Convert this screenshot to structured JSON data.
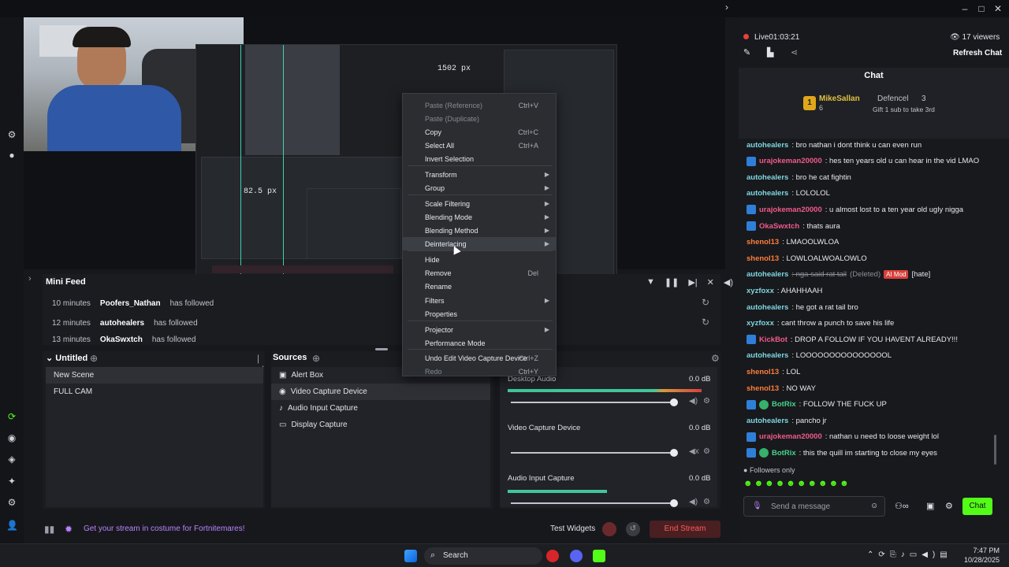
{
  "live": {
    "status_label": "Live",
    "timer": "01:03:21",
    "viewers": "17 viewers",
    "refresh_label": "Refresh Chat"
  },
  "chat": {
    "title": "Chat",
    "leader": {
      "rank": "1",
      "name": "MikeSallan",
      "count": "6",
      "runner_up": "Defencel",
      "runner_count": "3",
      "gift_text": "Gift 1 sub to take 3rd"
    },
    "lines": [
      {
        "user": "autohealers",
        "text": ": bro nathan i dont think u can even run",
        "style": "user"
      },
      {
        "user": "urajokeman20000",
        "text": ": hes ten years old u can hear in the vid LMAO",
        "style": "user-r"
      },
      {
        "user": "autohealers",
        "text": ": bro he cat fightin",
        "style": "user"
      },
      {
        "user": "autohealers",
        "text": ": LOLOLOL",
        "style": "user"
      },
      {
        "user": "urajokeman20000",
        "text": ": u almost lost to a ten year old ugly nigga",
        "style": "user-r"
      },
      {
        "user": "OkaSwxtch",
        "text": ": thats aura",
        "style": "user-r"
      },
      {
        "user": "shenol13",
        "text": ": LMAOOLWLOA",
        "style": "user-o"
      },
      {
        "user": "shenol13",
        "text": ": LOWLOALWOALOWLO",
        "style": "user-o"
      },
      {
        "user": "autohealers",
        "text": ": nga said rat tail",
        "style": "user",
        "deleted": "(Deleted)",
        "tag": "AI Mod",
        "extra": "[hate]"
      },
      {
        "user": "xyzfoxx",
        "text": ": AHAHHAAH",
        "style": "user"
      },
      {
        "user": "autohealers",
        "text": ": he got a rat tail bro",
        "style": "user"
      },
      {
        "user": "xyzfoxx",
        "text": ": cant throw a punch to save his life",
        "style": "user"
      },
      {
        "user": "KickBot",
        "text": ": DROP A FOLLOW IF YOU HAVENT ALREADY!!!",
        "style": "user-r"
      },
      {
        "user": "autohealers",
        "text": ": LOOOOOOOOOOOOOOOL",
        "style": "user"
      },
      {
        "user": "shenol13",
        "text": ": LOL",
        "style": "user-o"
      },
      {
        "user": "shenol13",
        "text": ": NO WAY",
        "style": "user-o"
      },
      {
        "user": "BotRix",
        "text": ": FOLLOW THE FUCK UP",
        "style": "user-g"
      },
      {
        "user": "autohealers",
        "text": ": pancho jr",
        "style": "user"
      },
      {
        "user": "urajokeman20000",
        "text": ": nathan u need to loose weight lol",
        "style": "user-r"
      },
      {
        "user": "BotRix",
        "text": ": this the quill im starting to close my eyes",
        "style": "user-g"
      }
    ],
    "followers_only": "Followers only",
    "placeholder": "Send a message",
    "send_label": "Chat"
  },
  "context_menu": {
    "items": [
      {
        "label": "Paste (Reference)",
        "shortcut": "Ctrl+V",
        "disabled": true
      },
      {
        "label": "Paste (Duplicate)",
        "shortcut": "",
        "disabled": true
      },
      {
        "label": "Copy",
        "shortcut": "Ctrl+C"
      },
      {
        "label": "Select All",
        "shortcut": "Ctrl+A"
      },
      {
        "label": "Invert Selection",
        "shortcut": ""
      },
      {
        "label": "Transform",
        "submenu": true
      },
      {
        "label": "Group",
        "submenu": true
      },
      {
        "label": "Scale Filtering",
        "submenu": true
      },
      {
        "label": "Blending Mode",
        "submenu": true
      },
      {
        "label": "Blending Method",
        "submenu": true
      },
      {
        "label": "Deinterlacing",
        "submenu": true,
        "highlight": true
      },
      {
        "label": "Hide"
      },
      {
        "label": "Remove",
        "shortcut": "Del"
      },
      {
        "label": "Rename"
      },
      {
        "label": "Filters",
        "submenu": true
      },
      {
        "label": "Properties"
      },
      {
        "label": "Projector",
        "submenu": true
      },
      {
        "label": "Performance Mode"
      },
      {
        "label": "Undo Edit Video Capture Device",
        "shortcut": "Ctrl+Z"
      },
      {
        "label": "Redo",
        "shortcut": "Ctrl+Y",
        "disabled": true
      }
    ]
  },
  "preview": {
    "px_top": "1502 px",
    "px_left": "82.5 px"
  },
  "minifeed": {
    "title": "Mini Feed",
    "rows": [
      {
        "time": "10 minutes",
        "user": "Poofers_Nathan",
        "action": "has followed"
      },
      {
        "time": "12 minutes",
        "user": "autohealers",
        "action": "has followed"
      },
      {
        "time": "13 minutes",
        "user": "OkaSwxtch",
        "action": "has followed"
      }
    ]
  },
  "scenes": {
    "title": "Untitled",
    "items": [
      "New Scene",
      "FULL CAM"
    ]
  },
  "sources": {
    "title": "Sources",
    "items": [
      {
        "label": "Alert Box",
        "icon": "image-icon"
      },
      {
        "label": "Video Capture Device",
        "icon": "camera-icon"
      },
      {
        "label": "Audio Input Capture",
        "icon": "mic-icon"
      },
      {
        "label": "Display Capture",
        "icon": "monitor-icon"
      }
    ]
  },
  "mixer": {
    "channels": [
      {
        "name": "Desktop Audio",
        "db": "0.0 dB"
      },
      {
        "name": "Video Capture Device",
        "db": "0.0 dB"
      },
      {
        "name": "Audio Input Capture",
        "db": "0.0 dB"
      }
    ]
  },
  "statusbar": {
    "promo": "Get your stream in costume for Fortnitemares!",
    "test_widgets": "Test Widgets",
    "end_stream": "End Stream"
  },
  "taskbar": {
    "search": "Search",
    "time": "7:47 PM",
    "date": "10/28/2025"
  },
  "colors": {
    "accent": "#53fc18",
    "live": "#e6413e",
    "end": "#ff4c4c"
  }
}
